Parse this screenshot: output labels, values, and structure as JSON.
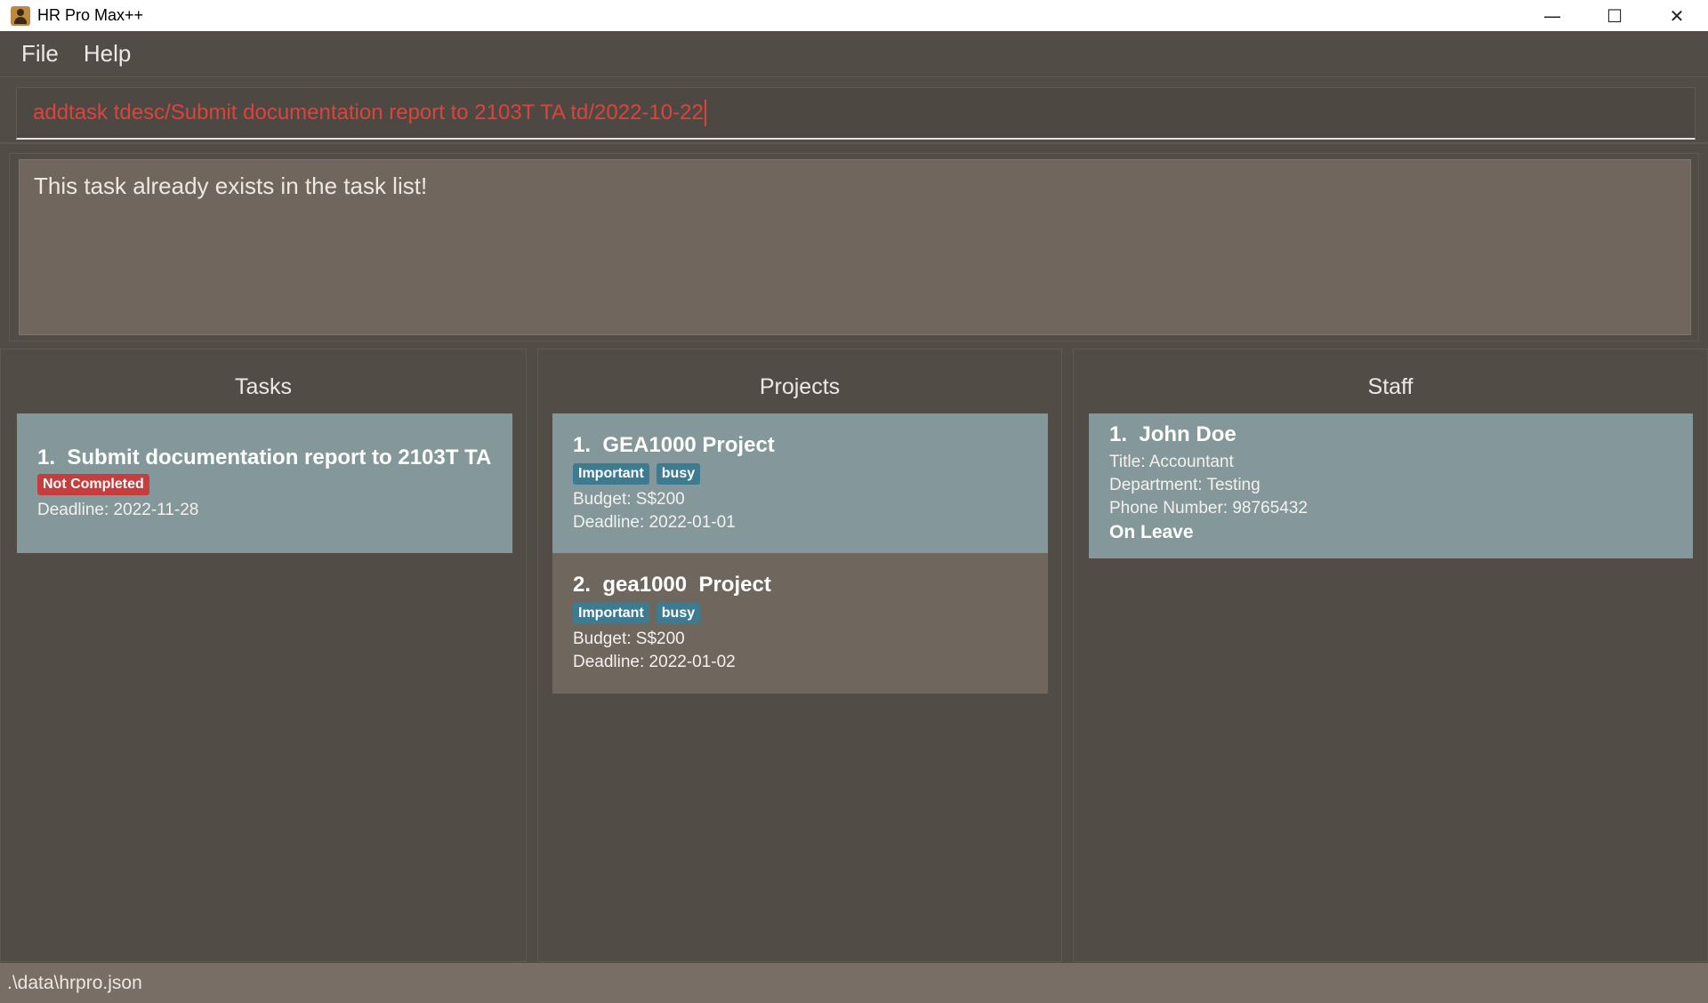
{
  "window": {
    "title": "HR Pro Max++",
    "controls": {
      "minimize": "—",
      "maximize": "☐",
      "close": "✕"
    }
  },
  "menu": {
    "items": [
      {
        "label": "File"
      },
      {
        "label": "Help"
      }
    ]
  },
  "command": {
    "value": "addtask tdesc/Submit documentation report to 2103T TA td/2022-10-22",
    "error_color": "#d9453d"
  },
  "result": {
    "message": "This task already exists in the task list!"
  },
  "tasks": {
    "title": "Tasks",
    "items": [
      {
        "index": "1.",
        "name": "Submit documentation report to 2103T TA",
        "status": "Not Completed",
        "deadline": "Deadline: 2022-11-28"
      }
    ]
  },
  "projects": {
    "title": "Projects",
    "items": [
      {
        "index": "1.",
        "name": "GEA1000 Project",
        "tags": [
          "Important",
          "busy"
        ],
        "budget": "Budget: S$200",
        "deadline": "Deadline: 2022-01-01"
      },
      {
        "index": "2.",
        "name": "gea1000  Project",
        "tags": [
          "Important",
          "busy"
        ],
        "budget": "Budget: S$200",
        "deadline": "Deadline: 2022-01-02"
      }
    ]
  },
  "staff": {
    "title": "Staff",
    "items": [
      {
        "index": "1.",
        "name": "John Doe",
        "title": "Title: Accountant",
        "department": "Department: Testing",
        "phone": "Phone Number: 98765432",
        "leave": "On Leave"
      }
    ]
  },
  "status_bar": {
    "path": ".\\data\\hrpro.json"
  },
  "colors": {
    "card_selected": "#84979a",
    "card_alt": "#6f665e",
    "tag": "#3e7b91",
    "not_completed": "#c63d3d"
  }
}
